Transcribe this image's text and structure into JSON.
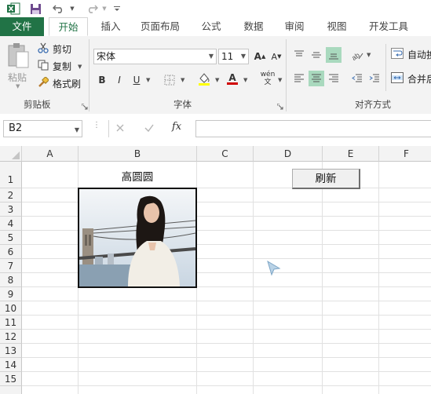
{
  "title_bar": {
    "app_icon": "excel-icon",
    "save_icon": "save-icon",
    "undo_icon": "undo-icon",
    "redo_icon": "redo-icon",
    "customize_icon": "customize-icon"
  },
  "tabs": {
    "file": "文件",
    "home": "开始",
    "insert": "插入",
    "page_layout": "页面布局",
    "formulas": "公式",
    "data": "数据",
    "review": "审阅",
    "view": "视图",
    "developer": "开发工具"
  },
  "clipboard": {
    "paste": "粘贴",
    "cut": "剪切",
    "copy": "复制",
    "format_painter": "格式刷",
    "group_label": "剪贴板"
  },
  "font": {
    "name": "宋体",
    "size": "11",
    "bold": "B",
    "italic": "I",
    "underline": "U",
    "font_color_letter": "A",
    "phonetic": "wén",
    "group_label": "字体"
  },
  "alignment": {
    "wrap_text": "自动换",
    "merge_center": "合并后",
    "group_label": "对齐方式"
  },
  "formula_bar": {
    "name_box": "B2",
    "fx": "fx",
    "formula": ""
  },
  "columns": [
    "A",
    "B",
    "C",
    "D",
    "E",
    "F"
  ],
  "rows": [
    "1",
    "2",
    "3",
    "4",
    "5",
    "6",
    "7",
    "8",
    "9",
    "10",
    "11",
    "12",
    "13",
    "14",
    "15"
  ],
  "cells": {
    "B1": "高圆圆"
  },
  "refresh_button": "刷新",
  "colors": {
    "accent": "#217346",
    "selected": "#a9d9be",
    "highlight_yellow": "#ffff00"
  }
}
